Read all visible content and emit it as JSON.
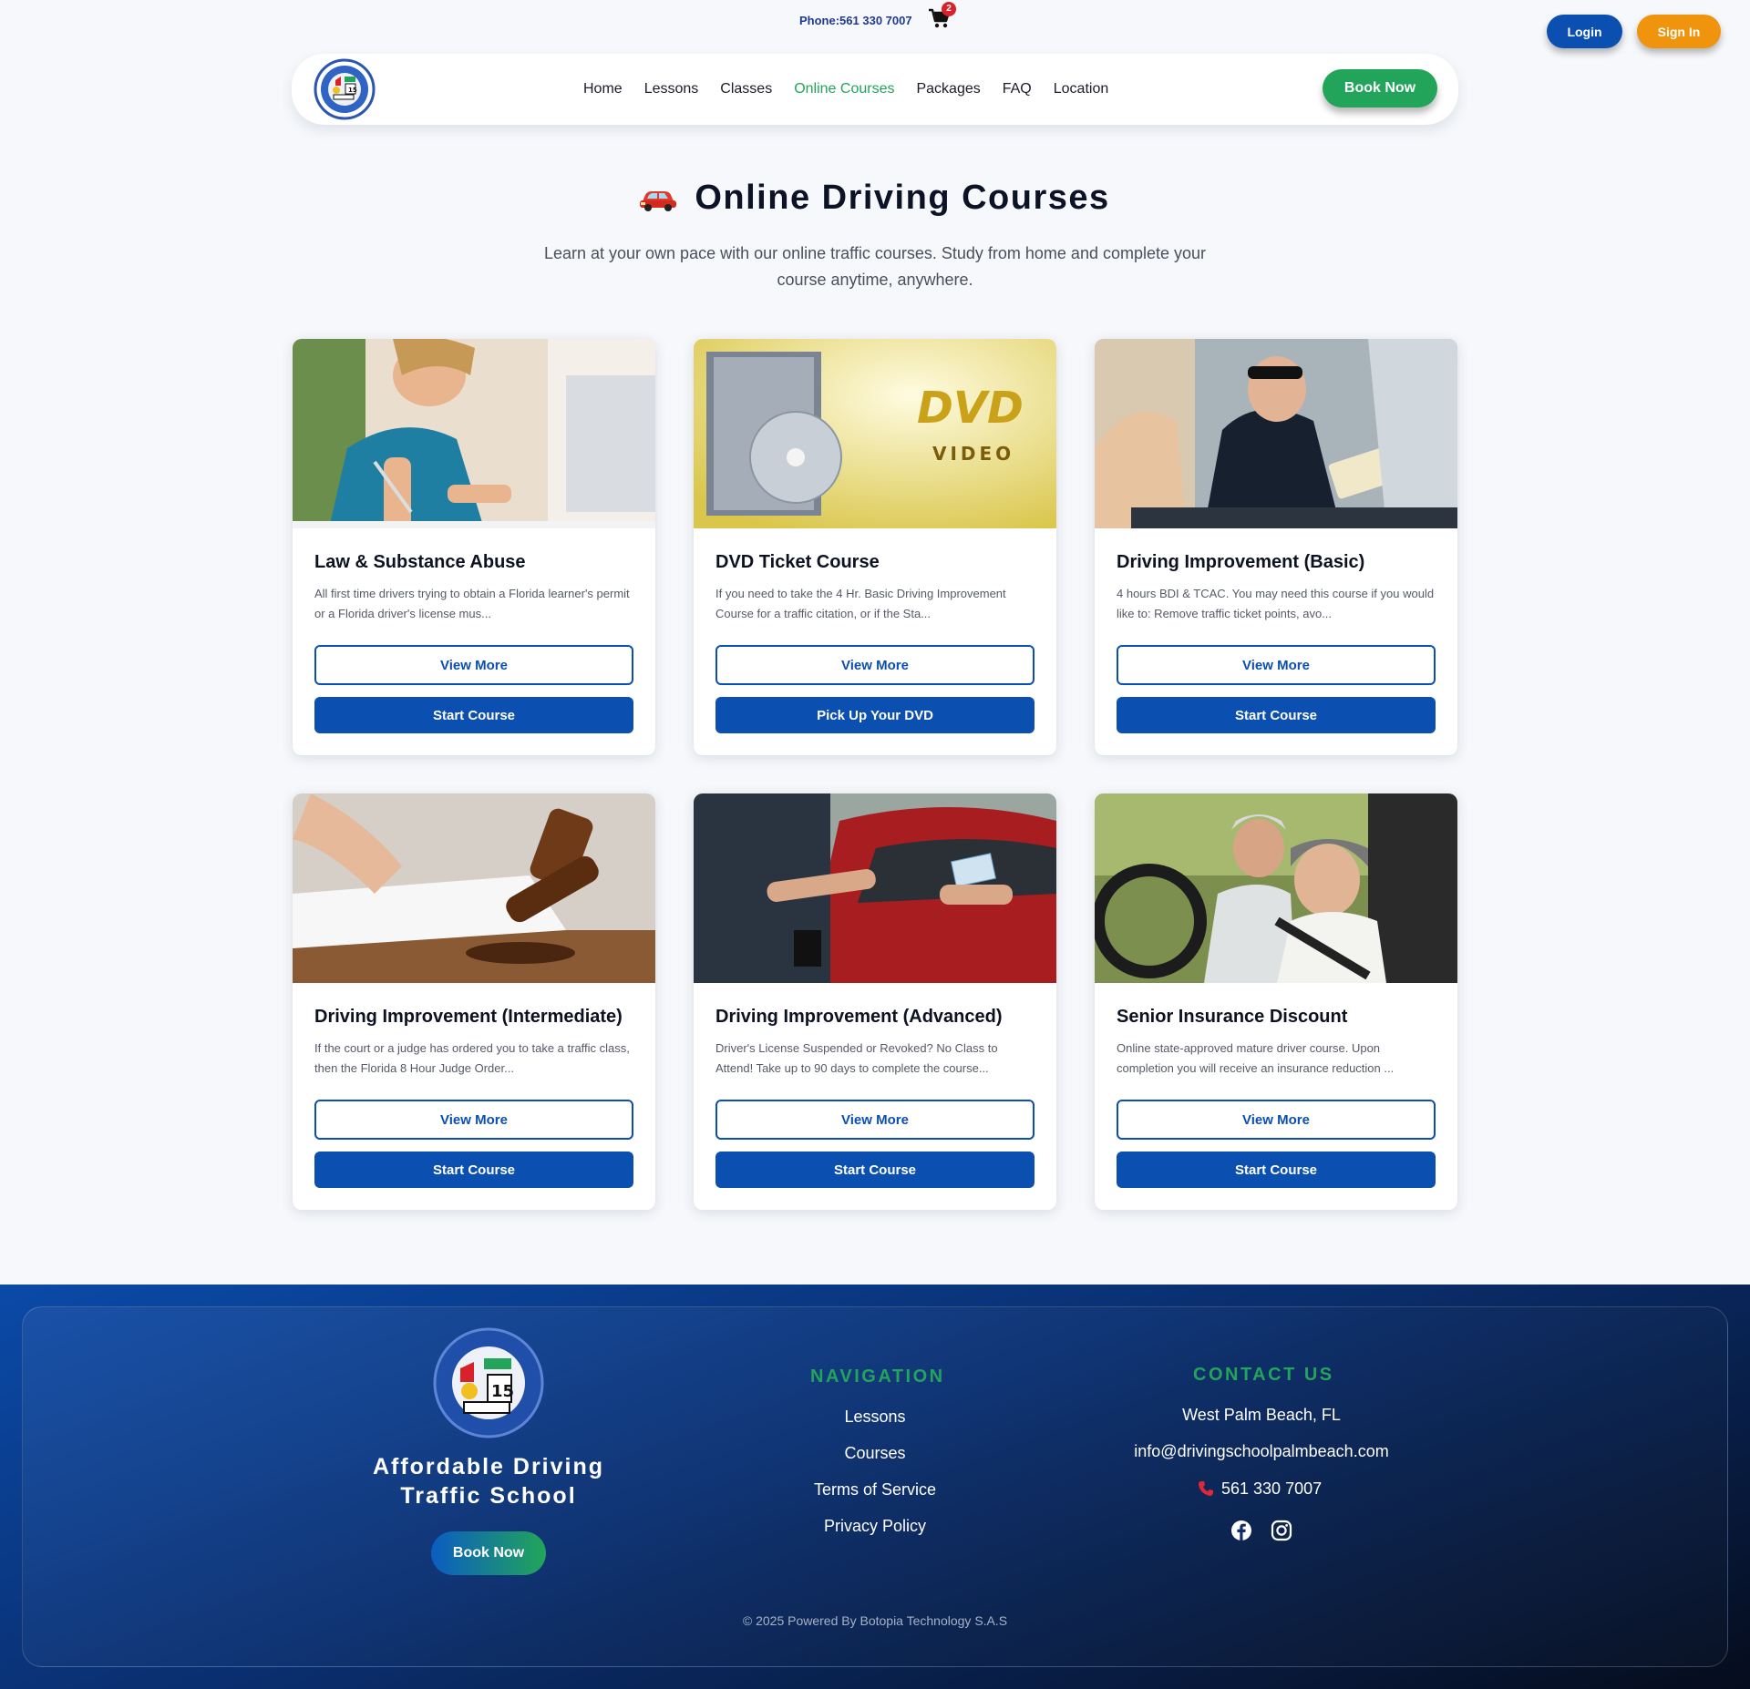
{
  "topbar": {
    "phone": "Phone:561 330 7007",
    "cart_count": "2",
    "login_label": "Login",
    "signin_label": "Sign In"
  },
  "nav": {
    "links": [
      "Home",
      "Lessons",
      "Classes",
      "Online Courses",
      "Packages",
      "FAQ",
      "Location"
    ],
    "active": "Online Courses",
    "book_label": "Book Now"
  },
  "hero": {
    "title": "Online Driving Courses",
    "subtitle": "Learn at your own pace with our online traffic courses. Study from home and complete your course anytime, anywhere."
  },
  "courses": [
    {
      "title": "Law & Substance Abuse",
      "desc": "All first time drivers trying to obtain a Florida learner's permit or a Florida driver's license mus...",
      "more": "View More",
      "action": "Start Course"
    },
    {
      "title": "DVD Ticket Course",
      "desc": "If you need to take the 4 Hr. Basic Driving Improvement Course for a traffic citation, or if the Sta...",
      "more": "View More",
      "action": "Pick Up Your DVD"
    },
    {
      "title": "Driving Improvement (Basic)",
      "desc": "4 hours BDI & TCAC. You may need this course if you would like to: Remove traffic ticket points, avo...",
      "more": "View More",
      "action": "Start Course"
    },
    {
      "title": "Driving Improvement (Intermediate)",
      "desc": "If the court or a judge has ordered you to take a traffic class, then the Florida 8 Hour Judge Order...",
      "more": "View More",
      "action": "Start Course"
    },
    {
      "title": "Driving Improvement (Advanced)",
      "desc": "Driver's License Suspended or Revoked? No Class to Attend! Take up to 90 days to complete the course...",
      "more": "View More",
      "action": "Start Course"
    },
    {
      "title": "Senior Insurance Discount",
      "desc": "Online state-approved mature driver course. Upon completion you will receive an insurance reduction ...",
      "more": "View More",
      "action": "Start Course"
    }
  ],
  "footer": {
    "brand_line1": "Affordable Driving",
    "brand_line2": "Traffic School",
    "book_label": "Book Now",
    "nav_heading": "NAVIGATION",
    "nav_links": [
      "Lessons",
      "Courses",
      "Terms of Service",
      "Privacy Policy"
    ],
    "contact_heading": "CONTACT US",
    "location": "West Palm Beach, FL",
    "email": "info@drivingschoolpalmbeach.com",
    "phone": "561 330 7007",
    "copyright": "© 2025 Powered By Botopia Technology S.A.S"
  },
  "colors": {
    "brand_blue": "#0b4fb0",
    "brand_green": "#22a55a",
    "brand_orange": "#f0940e",
    "cart_badge": "#d8222a"
  },
  "icons": [
    "cart-icon",
    "car-icon",
    "phone-icon",
    "facebook-icon",
    "instagram-icon",
    "logo-seal"
  ]
}
